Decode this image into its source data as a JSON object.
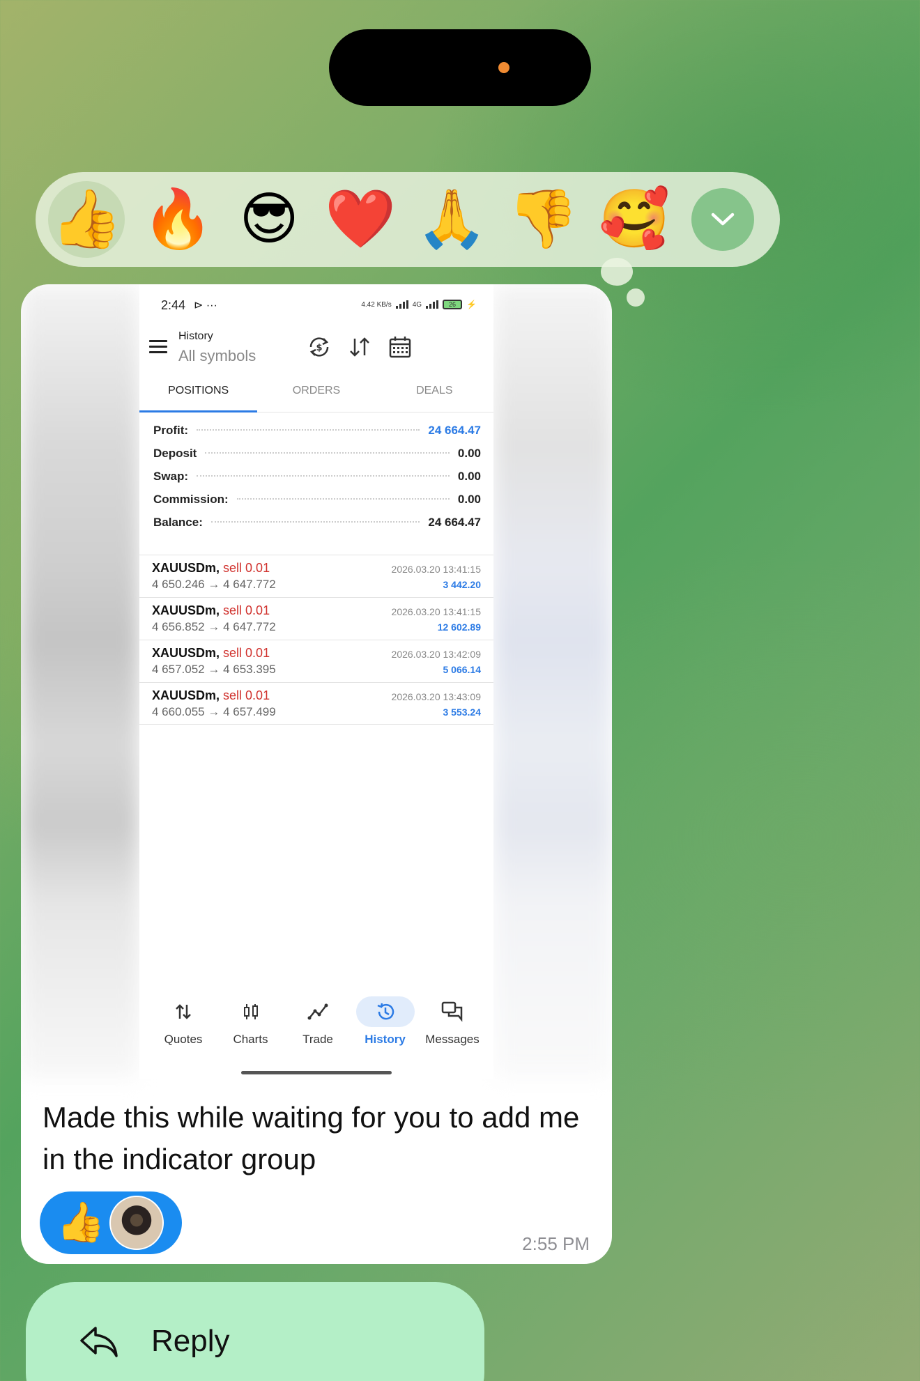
{
  "reactions": {
    "items": [
      {
        "name": "thumbs-up",
        "glyph": "👍",
        "selected": true
      },
      {
        "name": "fire",
        "glyph": "🔥"
      },
      {
        "name": "sunglasses",
        "glyph": "😎"
      },
      {
        "name": "red-heart",
        "glyph": "❤️"
      },
      {
        "name": "folded-hands",
        "glyph": "🙏"
      },
      {
        "name": "thumbs-down",
        "glyph": "👎"
      },
      {
        "name": "smiling-face-with-hearts",
        "glyph": "🥰"
      }
    ],
    "more_icon": "chevron-down-icon"
  },
  "screenshot": {
    "status_time": "2:44",
    "status_extra": "⊳ ···",
    "network_rate": "4.42 KB/s",
    "network_type": "4G",
    "battery": "26",
    "header_title": "History",
    "header_subtitle": "All symbols",
    "tabs": [
      "POSITIONS",
      "ORDERS",
      "DEALS"
    ],
    "summary": [
      {
        "label": "Profit:",
        "value": "24 664.47",
        "highlight": true
      },
      {
        "label": "Deposit",
        "value": "0.00"
      },
      {
        "label": "Swap:",
        "value": "0.00"
      },
      {
        "label": "Commission:",
        "value": "0.00"
      },
      {
        "label": "Balance:",
        "value": "24 664.47"
      }
    ],
    "deals": [
      {
        "symbol": "XAUUSDm,",
        "side": "sell 0.01",
        "prices": "4 650.246 → 4 647.772",
        "datetime": "2026.03.20 13:41:15",
        "profit": "3 442.20"
      },
      {
        "symbol": "XAUUSDm,",
        "side": "sell 0.01",
        "prices": "4 656.852 → 4 647.772",
        "datetime": "2026.03.20 13:41:15",
        "profit": "12 602.89"
      },
      {
        "symbol": "XAUUSDm,",
        "side": "sell 0.01",
        "prices": "4 657.052 → 4 653.395",
        "datetime": "2026.03.20 13:42:09",
        "profit": "5 066.14"
      },
      {
        "symbol": "XAUUSDm,",
        "side": "sell 0.01",
        "prices": "4 660.055 → 4 657.499",
        "datetime": "2026.03.20 13:43:09",
        "profit": "3 553.24"
      }
    ],
    "nav": [
      {
        "label": "Quotes",
        "icon": "quotes-icon"
      },
      {
        "label": "Charts",
        "icon": "charts-icon"
      },
      {
        "label": "Trade",
        "icon": "trade-icon"
      },
      {
        "label": "History",
        "icon": "history-icon",
        "active": true
      },
      {
        "label": "Messages",
        "icon": "messages-icon"
      }
    ]
  },
  "message": {
    "caption": "Made this while waiting for you to add me in the indicator group",
    "reaction_glyph": "👍",
    "time": "2:55 PM"
  },
  "context_menu": {
    "reply_label": "Reply"
  },
  "colors": {
    "accent_blue": "#2c7be5",
    "sell_red": "#d0312d",
    "reaction_pill": "#1a8cf0",
    "reply_menu": "#b4efc7"
  }
}
